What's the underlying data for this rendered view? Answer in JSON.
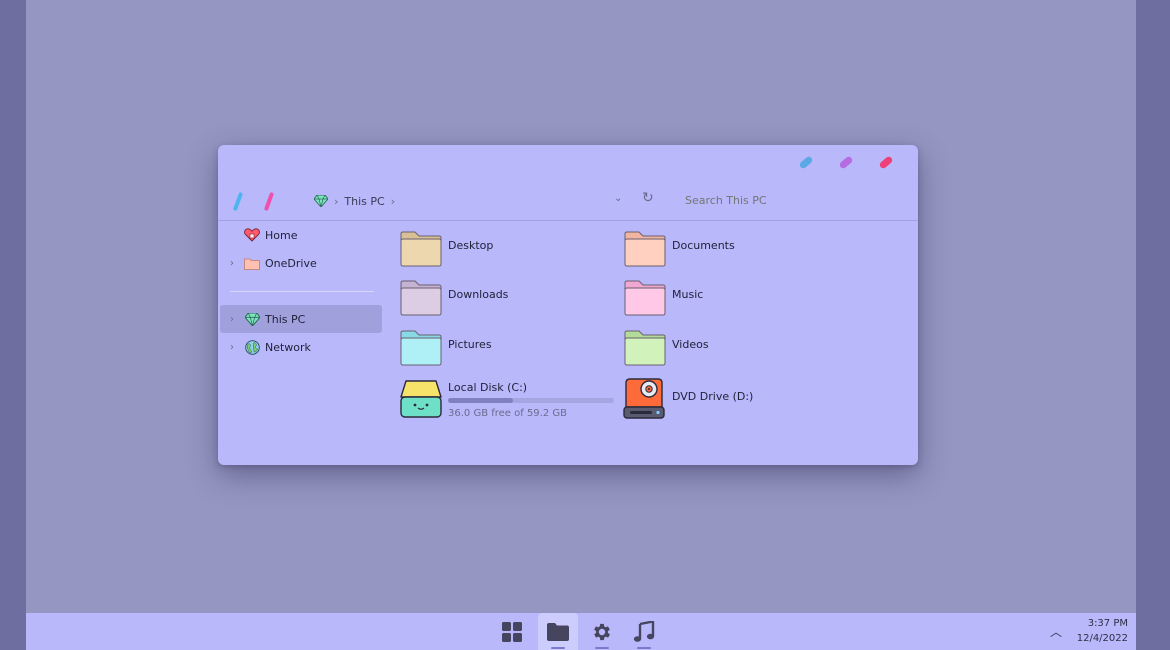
{
  "window": {
    "controls": {
      "minimize_color": "#5aa8e6",
      "maximize_color": "#b66be0",
      "close_color": "#ee3f78"
    },
    "nav": {
      "back_color": "#4fb3f0",
      "forward_color": "#f04fae"
    },
    "address": {
      "icon": "gem-icon",
      "location": "This PC"
    },
    "search": {
      "placeholder": "Search This PC"
    }
  },
  "sidebar": {
    "items": [
      {
        "label": "Home",
        "icon": "heart-house-icon",
        "expandable": false,
        "selected": false
      },
      {
        "label": "OneDrive",
        "icon": "folder-icon",
        "expandable": true,
        "selected": false
      },
      {
        "label": "This PC",
        "icon": "gem-icon",
        "expandable": true,
        "selected": true
      },
      {
        "label": "Network",
        "icon": "globe-icon",
        "expandable": true,
        "selected": false
      }
    ]
  },
  "folders": [
    {
      "label": "Desktop",
      "color": "#ecd7ae",
      "tab": "#d8c096"
    },
    {
      "label": "Documents",
      "color": "#ffd0c0",
      "tab": "#f0b4a0"
    },
    {
      "label": "Downloads",
      "color": "#dccde4",
      "tab": "#c6b2d2"
    },
    {
      "label": "Music",
      "color": "#ffc8e6",
      "tab": "#f0a8d0"
    },
    {
      "label": "Pictures",
      "color": "#aef0f6",
      "tab": "#88d8e6"
    },
    {
      "label": "Videos",
      "color": "#d2f2bc",
      "tab": "#b2dc98"
    }
  ],
  "drives": [
    {
      "label": "Local Disk (C:)",
      "free_text": "36.0 GB free of 59.2 GB",
      "used_fraction": 0.39
    },
    {
      "label": "DVD Drive (D:)"
    }
  ],
  "taskbar": {
    "apps": [
      {
        "icon": "windows-start-icon",
        "active": false
      },
      {
        "icon": "folder-icon",
        "active": true
      },
      {
        "icon": "gear-icon",
        "active": false
      },
      {
        "icon": "music-note-icon",
        "active": false
      }
    ],
    "time": "3:37 PM",
    "date": "12/4/2022"
  }
}
